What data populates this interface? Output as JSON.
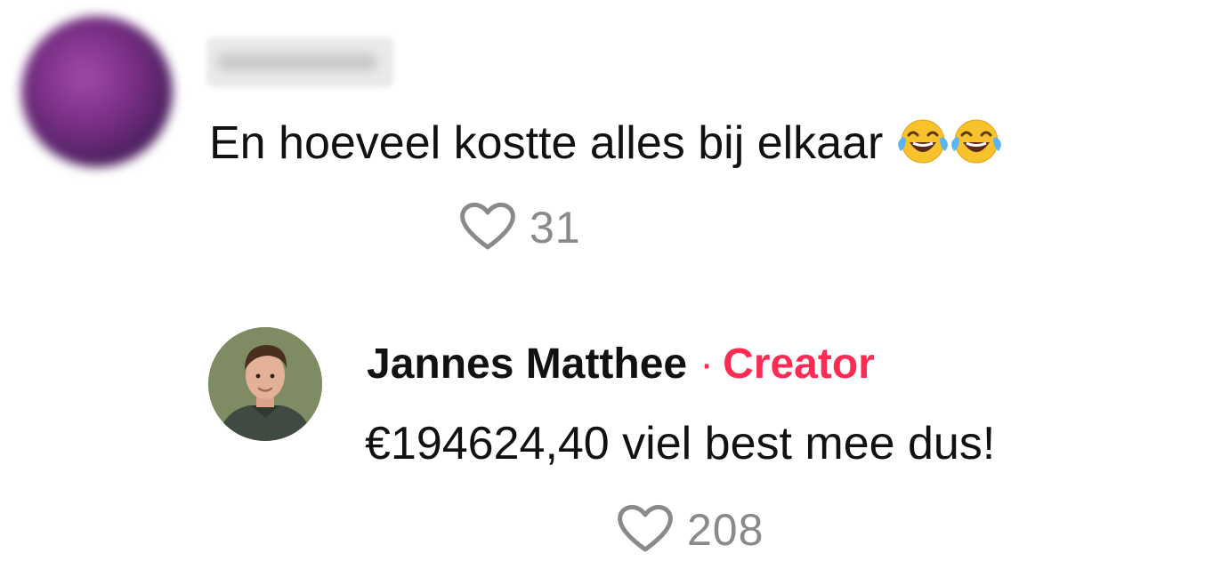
{
  "first_comment": {
    "username": "",
    "text": "En hoeveel kostte alles bij elkaar",
    "emoji": [
      "face-with-tears-of-joy",
      "face-with-tears-of-joy"
    ],
    "likes": "31"
  },
  "reply": {
    "author_name": "Jannes Matthee",
    "separator": "·",
    "badge": "Creator",
    "text": "€194624,40 viel best mee dus!",
    "likes": "208"
  },
  "colors": {
    "badge": "#fe2c55",
    "text": "#111111",
    "muted": "#8a8a8a"
  }
}
